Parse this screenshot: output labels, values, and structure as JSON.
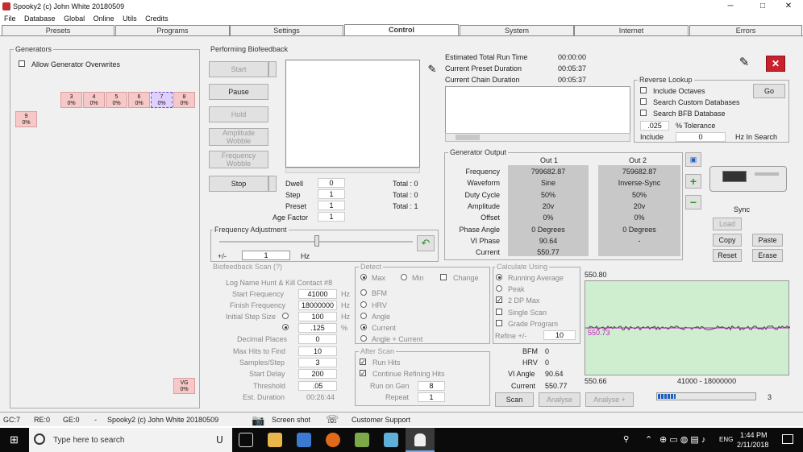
{
  "window": {
    "title": "Spooky2 (c) John White 20180509",
    "min": "─",
    "max": "□",
    "close": "✕"
  },
  "menu": [
    "File",
    "Database",
    "Global",
    "Online",
    "Utils",
    "Credits"
  ],
  "tabs": [
    "Presets",
    "Programs",
    "Settings",
    "Control",
    "System",
    "Internet",
    "Errors"
  ],
  "generators": {
    "legend": "Generators",
    "allow_overwrites": "Allow Generator Overwrites",
    "items": [
      {
        "num": "3",
        "sub": "0%"
      },
      {
        "num": "4",
        "sub": "0%"
      },
      {
        "num": "5",
        "sub": "0%"
      },
      {
        "num": "6",
        "sub": "0%"
      },
      {
        "num": "7",
        "sub": "0%"
      },
      {
        "num": "8",
        "sub": "0%"
      }
    ],
    "g9": {
      "num": "9",
      "sub": "0%"
    },
    "vg": {
      "num": "VG",
      "sub": "0%"
    }
  },
  "biofeedback": {
    "legend": "Performing Biofeedback",
    "start": "Start",
    "pause": "Pause",
    "hold": "Hold",
    "amplitude_wobble": "Amplitude Wobble",
    "frequency_wobble": "Frequency Wobble",
    "stop": "Stop",
    "dwell_label": "Dwell",
    "dwell": "0",
    "step_label": "Step",
    "step": "1",
    "preset_label": "Preset",
    "preset": "1",
    "age_label": "Age Factor",
    "age": "1",
    "total1": "Total : 0",
    "total2": "Total : 0",
    "total3": "Total : 1"
  },
  "freq_adjust": {
    "legend": "Frequency Adjustment",
    "pm": "+/-",
    "value": "1",
    "unit": "Hz"
  },
  "run": {
    "est_label": "Estimated Total Run Time",
    "est": "00:00:00",
    "preset_label": "Current Preset Duration",
    "preset": "00:05:37",
    "chain_label": "Current Chain Duration",
    "chain": "00:05:37"
  },
  "reverse": {
    "legend": "Reverse Lookup",
    "include_octaves": "Include Octaves",
    "search_custom": "Search Custom Databases",
    "search_bfb": "Search BFB Database",
    "tol_value": ".025",
    "tol_label": "% Tolerance",
    "include_label": "Include",
    "include_value": "0",
    "hz_label": "Hz In Search",
    "go": "Go"
  },
  "genout": {
    "legend": "Generator Output",
    "out1": "Out 1",
    "out2": "Out 2",
    "rows": [
      {
        "label": "Frequency",
        "o1": "799682.87",
        "o2": "759682.87"
      },
      {
        "label": "Waveform",
        "o1": "Sine",
        "o2": "Inverse-Sync"
      },
      {
        "label": "Duty Cycle",
        "o1": "50%",
        "o2": "50%"
      },
      {
        "label": "Amplitude",
        "o1": "20v",
        "o2": "20v"
      },
      {
        "label": "Offset",
        "o1": "0%",
        "o2": "0%"
      },
      {
        "label": "Phase Angle",
        "o1": "0 Degrees",
        "o2": "0 Degrees"
      },
      {
        "label": "VI Phase",
        "o1": "90.64",
        "o2": "-"
      },
      {
        "label": "Current",
        "o1": "550.77",
        "o2": ""
      }
    ]
  },
  "device": {
    "sync": "Sync",
    "load": "Load",
    "copy": "Copy",
    "paste": "Paste",
    "reset": "Reset",
    "erase": "Erase"
  },
  "scan": {
    "legend": "Biofeedback Scan (?)",
    "log_name": "Log Name Hunt & Kill Contact #8",
    "start_label": "Start Frequency",
    "start": "41000",
    "hz1": "Hz",
    "finish_label": "Finish Frequency",
    "finish": "18000000",
    "hz2": "Hz",
    "step_label": "Initial Step Size",
    "step": "100",
    "hz3": "Hz",
    "step2": ".125",
    "pct": "%",
    "dec_label": "Decimal Places",
    "dec": "0",
    "hits_label": "Max Hits to Find",
    "hits": "10",
    "samples_label": "Samples/Step",
    "samples": "3",
    "delay_label": "Start Delay",
    "delay": "200",
    "thresh_label": "Threshold",
    "thresh": ".05",
    "dur_label": "Est. Duration",
    "dur": "00:26:44"
  },
  "detect": {
    "legend": "Detect",
    "max": "Max",
    "min": "Min",
    "change": "Change",
    "bfm": "BFM",
    "hrv": "HRV",
    "angle": "Angle",
    "current": "Current",
    "angle_current": "Angle + Current"
  },
  "after": {
    "legend": "After Scan",
    "run_hits": "Run Hits",
    "continue": "Continue Refining Hits",
    "run_gen_label": "Run on Gen",
    "run_gen": "8",
    "repeat_label": "Repeat",
    "repeat": "1"
  },
  "calc": {
    "legend": "Calculate Using",
    "running": "Running Average",
    "peak": "Peak",
    "max2dp": "2 DP Max",
    "single": "Single Scan",
    "grade": "Grade Program",
    "refine_label": "Refine +/-",
    "refine": "10"
  },
  "readings": {
    "bfm_label": "BFM",
    "bfm": "0",
    "hrv_label": "HRV",
    "hrv": "0",
    "vi_label": "VI Angle",
    "vi": "90.64",
    "cur_label": "Current",
    "cur": "550.77"
  },
  "graph": {
    "top": "550.80",
    "mid": "550.73",
    "bottom": "550.66",
    "range": "41000 - 18000000",
    "progress": 0.18,
    "progress_end": "3"
  },
  "scan_buttons": {
    "scan": "Scan",
    "analyse": "Analyse",
    "analyse_plus": "Analyse +"
  },
  "status": {
    "gc": "GC:7",
    "re": "RE:0",
    "ge": "GE:0",
    "dash": "-",
    "title": "Spooky2 (c) John White 20180509",
    "screenshot": "Screen shot",
    "support": "Customer Support"
  },
  "taskbar": {
    "search": "Type here to search",
    "lang": "ENG",
    "time": "1:44 PM",
    "date": "2/11/2018"
  },
  "colors": {
    "accent": "#1f5fbf",
    "graph_bg": "#cfeecf",
    "gen_red": "#f7c8c8",
    "close_red": "#c8232c"
  }
}
